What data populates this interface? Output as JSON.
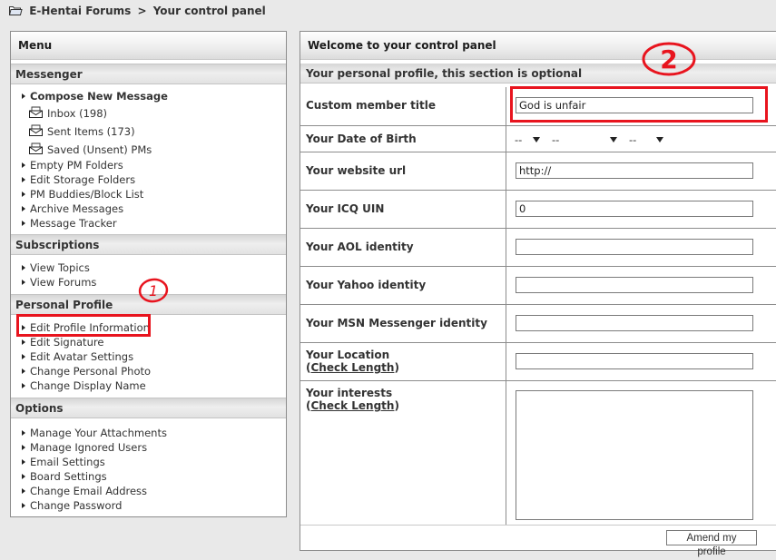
{
  "breadcrumb": {
    "icon": "folder-icon",
    "site": "E-Hentai Forums",
    "separator": ">",
    "current": "Your control panel"
  },
  "menu": {
    "title": "Menu",
    "sections": [
      {
        "title": "Messenger",
        "items": [
          {
            "label": "Compose New Message",
            "bold": true
          },
          {
            "label": "Inbox (198)",
            "icon": "envelope-icon"
          },
          {
            "label": "Sent Items (173)",
            "icon": "envelope-icon"
          },
          {
            "label": "Saved (Unsent) PMs",
            "icon": "envelope-icon"
          },
          {
            "label": "Empty PM Folders"
          },
          {
            "label": "Edit Storage Folders"
          },
          {
            "label": "PM Buddies/Block List"
          },
          {
            "label": "Archive Messages"
          },
          {
            "label": "Message Tracker"
          }
        ]
      },
      {
        "title": "Subscriptions",
        "items": [
          {
            "label": "View Topics"
          },
          {
            "label": "View Forums"
          }
        ]
      },
      {
        "title": "Personal Profile",
        "items": [
          {
            "label": "Edit Profile Information"
          },
          {
            "label": "Edit Signature"
          },
          {
            "label": "Edit Avatar Settings"
          },
          {
            "label": "Change Personal Photo"
          },
          {
            "label": "Change Display Name"
          }
        ]
      },
      {
        "title": "Options",
        "items": [
          {
            "label": "Manage Your Attachments"
          },
          {
            "label": "Manage Ignored Users"
          },
          {
            "label": "Email Settings"
          },
          {
            "label": "Board Settings"
          },
          {
            "label": "Change Email Address"
          },
          {
            "label": "Change Password"
          }
        ]
      }
    ]
  },
  "main": {
    "title": "Welcome to your control panel",
    "subtitle": "Your personal profile, this section is optional",
    "fields": {
      "member_title": {
        "label": "Custom member title",
        "value": "God is unfair"
      },
      "dob": {
        "label": "Your Date of Birth",
        "month": "--",
        "day": "--",
        "year": "--"
      },
      "website": {
        "label": "Your website url",
        "value": "http://"
      },
      "icq": {
        "label": "Your ICQ UIN",
        "value": "0"
      },
      "aol": {
        "label": "Your AOL identity",
        "value": ""
      },
      "yahoo": {
        "label": "Your Yahoo identity",
        "value": ""
      },
      "msn": {
        "label": "Your MSN Messenger identity",
        "value": ""
      },
      "location": {
        "label": "Your Location",
        "check": "Check Length",
        "value": ""
      },
      "interests": {
        "label": "Your interests",
        "check": "Check Length",
        "value": ""
      }
    },
    "submit_label": "Amend my profile"
  },
  "annotations": {
    "color": "#e8141e",
    "marker_1": "1",
    "marker_2": "2"
  }
}
